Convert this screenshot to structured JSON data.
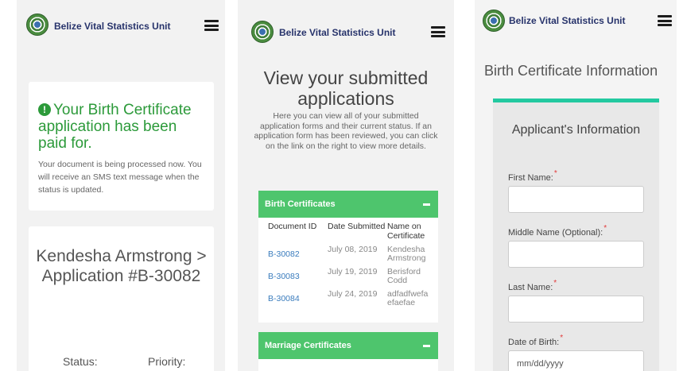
{
  "brand": {
    "name": "Belize Vital Statistics Unit"
  },
  "panel1": {
    "success_title": "Your Birth Certificate application has been paid for.",
    "success_text": "Your document is being processed now. You will receive an SMS text message when the status is updated.",
    "application_title": "Kendesha Armstrong > Application #B-30082",
    "status_label": "Status:",
    "priority_label": "Priority:"
  },
  "panel2": {
    "title": "View your submitted applications",
    "intro": "Here you can view all of your submitted application forms and their current status. If an application form has been reviewed, you can click on the link on the right to view more details.",
    "birth_section": {
      "title": "Birth Certificates",
      "columns": [
        "Document ID",
        "Date Submitted",
        "Name on Certificate"
      ],
      "rows": [
        {
          "id": "B-30082",
          "date": "July 08, 2019",
          "name": "Kendesha Armstrong"
        },
        {
          "id": "B-30083",
          "date": "July 19, 2019",
          "name": "Berisford Codd"
        },
        {
          "id": "B-30084",
          "date": "July 24, 2019",
          "name": "adfadfwefa efaefae"
        }
      ]
    },
    "marriage_section": {
      "title": "Marriage Certificates"
    }
  },
  "panel3": {
    "title": "Birth Certificate Information",
    "form_header": "Applicant's Information",
    "required_marker": "*",
    "fields": {
      "first_name": {
        "label": "First Name:",
        "value": ""
      },
      "middle_name": {
        "label": "Middle Name (Optional):",
        "value": ""
      },
      "last_name": {
        "label": "Last Name:",
        "value": ""
      },
      "dob": {
        "label": "Date of Birth:",
        "placeholder": "mm/dd/yyyy",
        "value": ""
      }
    }
  },
  "icons": {
    "menu": "hamburger-menu-icon",
    "alert": "exclamation-circle-icon",
    "collapse": "minus-icon",
    "logo": "belize-seal-logo"
  },
  "colors": {
    "success_green": "#2c9a3a",
    "section_green": "#4ec56d",
    "form_accent": "#23c9a0",
    "link_blue": "#3a7cbd",
    "brand_navy": "#27336b",
    "required_red": "#e23a3a"
  }
}
